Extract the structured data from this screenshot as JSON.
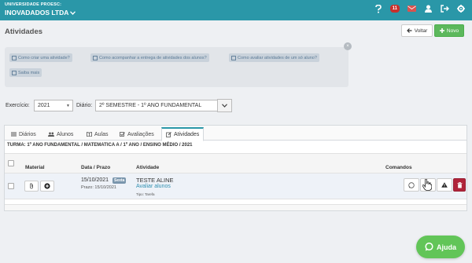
{
  "header": {
    "institution": "UNIVERSIDADE PROESC:",
    "company": "INOVADADOS LTDA",
    "notifications_count": "11",
    "icons": [
      "help-icon",
      "mail-icon",
      "user-icon",
      "logout-icon",
      "settings-icon"
    ]
  },
  "page": {
    "title": "Atividades",
    "back_label": "Voltar",
    "new_label": "Novo"
  },
  "help": {
    "links": [
      "Como criar uma atividade?",
      "Como acompanhar a entrega de atividades dos alunos?",
      "Como avaliar atividades de um só aluno?",
      "Saiba mais"
    ],
    "close": "×"
  },
  "filters": {
    "exercicio_label": "Exercício:",
    "exercicio_value": "2021",
    "diario_label": "Diário:",
    "diario_value": "2º SEMESTRE - 1º ANO FUNDAMENTAL"
  },
  "tabs": [
    {
      "label": "Diários",
      "icon": "list-icon"
    },
    {
      "label": "Alunos",
      "icon": "users-icon"
    },
    {
      "label": "Aulas",
      "icon": "book-icon"
    },
    {
      "label": "Avaliações",
      "icon": "check-icon"
    },
    {
      "label": "Atividades",
      "icon": "edit-icon",
      "active": true
    }
  ],
  "turma": "TURMA: 1º ANO FUNDAMENTAL / MATEMATICA A / 1º ANO / ENSINO MÉDIO / 2021",
  "table": {
    "columns": [
      "Material",
      "Data / Prazo",
      "Atividade",
      "Comandos"
    ],
    "rows": [
      {
        "date": "15/10/2021",
        "day_badge": "Sexta",
        "prazo": "Prazo: 15/10/2021",
        "title": "TESTE ALINE",
        "link": "Avaliar alunos",
        "type": "Tipo: Tarefa"
      }
    ]
  },
  "help_button": {
    "label": "Ajuda"
  },
  "colors": {
    "topbar": "#2a97a8",
    "success": "#5cb85c",
    "danger": "#b0243a",
    "badge": "#c9302c",
    "help_bubble": "#62c558"
  }
}
